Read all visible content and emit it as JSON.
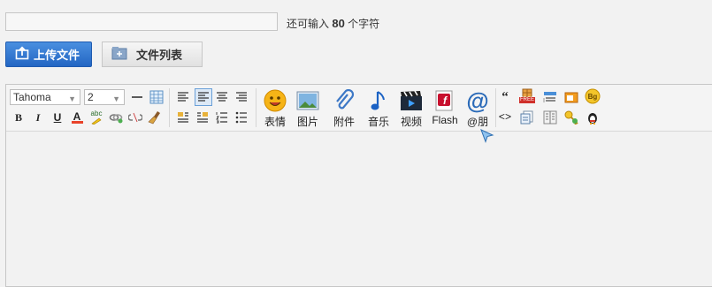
{
  "title_field": {
    "value": "",
    "placeholder": ""
  },
  "char_remaining": {
    "prefix": "还可输入",
    "count": "80",
    "suffix": "个字符"
  },
  "buttons": {
    "upload": "上传文件",
    "file_list": "文件列表"
  },
  "toolbar": {
    "font_family": "Tahoma",
    "font_size": "2",
    "media": {
      "emoticon": "表情",
      "image": "图片",
      "attachment": "附件",
      "music": "音乐",
      "video": "视频",
      "flash": "Flash",
      "mention": "@朋"
    },
    "icons_text": {
      "bold": "B",
      "italic": "I",
      "underline": "U",
      "font_color": "A",
      "highlight": "abc",
      "quote": "“",
      "code": "<>",
      "free_badge": "FREE",
      "bg_badge": "Bg",
      "flash_glyph": "f",
      "mention_glyph": "@"
    }
  },
  "colors": {
    "primary": "#2366c3",
    "background": "#f2f2f2",
    "border": "#c6c6c6"
  }
}
